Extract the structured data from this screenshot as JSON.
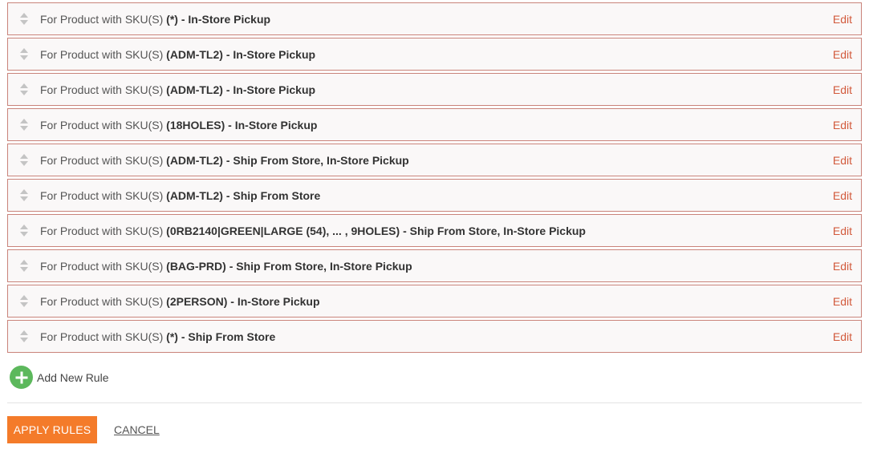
{
  "rules": [
    {
      "prefix": "For Product with SKU(S)",
      "sku": "(*)",
      "separator": "-",
      "method": "In-Store Pickup",
      "edit_label": "Edit"
    },
    {
      "prefix": "For Product with SKU(S)",
      "sku": "(ADM-TL2)",
      "separator": "-",
      "method": "In-Store Pickup",
      "edit_label": "Edit"
    },
    {
      "prefix": "For Product with SKU(S)",
      "sku": "(ADM-TL2)",
      "separator": "-",
      "method": "In-Store Pickup",
      "edit_label": "Edit"
    },
    {
      "prefix": "For Product with SKU(S)",
      "sku": "(18HOLES)",
      "separator": "-",
      "method": "In-Store Pickup",
      "edit_label": "Edit"
    },
    {
      "prefix": "For Product with SKU(S)",
      "sku": "(ADM-TL2)",
      "separator": "-",
      "method": "Ship From Store, In-Store Pickup",
      "edit_label": "Edit"
    },
    {
      "prefix": "For Product with SKU(S)",
      "sku": "(ADM-TL2)",
      "separator": "-",
      "method": "Ship From Store",
      "edit_label": "Edit"
    },
    {
      "prefix": "For Product with SKU(S)",
      "sku": "(0RB2140|GREEN|LARGE (54), ... , 9HOLES)",
      "separator": "-",
      "method": "Ship From Store, In-Store Pickup",
      "edit_label": "Edit"
    },
    {
      "prefix": "For Product with SKU(S)",
      "sku": "(BAG-PRD)",
      "separator": "-",
      "method": "Ship From Store, In-Store Pickup",
      "edit_label": "Edit"
    },
    {
      "prefix": "For Product with SKU(S)",
      "sku": "(2PERSON)",
      "separator": "-",
      "method": "In-Store Pickup",
      "edit_label": "Edit"
    },
    {
      "prefix": "For Product with SKU(S)",
      "sku": "(*)",
      "separator": "-",
      "method": "Ship From Store",
      "edit_label": "Edit"
    }
  ],
  "add_rule": {
    "label": "Add New Rule",
    "icon": "plus-circle-icon"
  },
  "actions": {
    "apply_label": "APPLY RULES",
    "cancel_label": "CANCEL"
  },
  "colors": {
    "row_border": "#c9837a",
    "edit_link": "#d25a3c",
    "add_icon": "#5cb85c",
    "apply_button": "#f47b2a"
  }
}
